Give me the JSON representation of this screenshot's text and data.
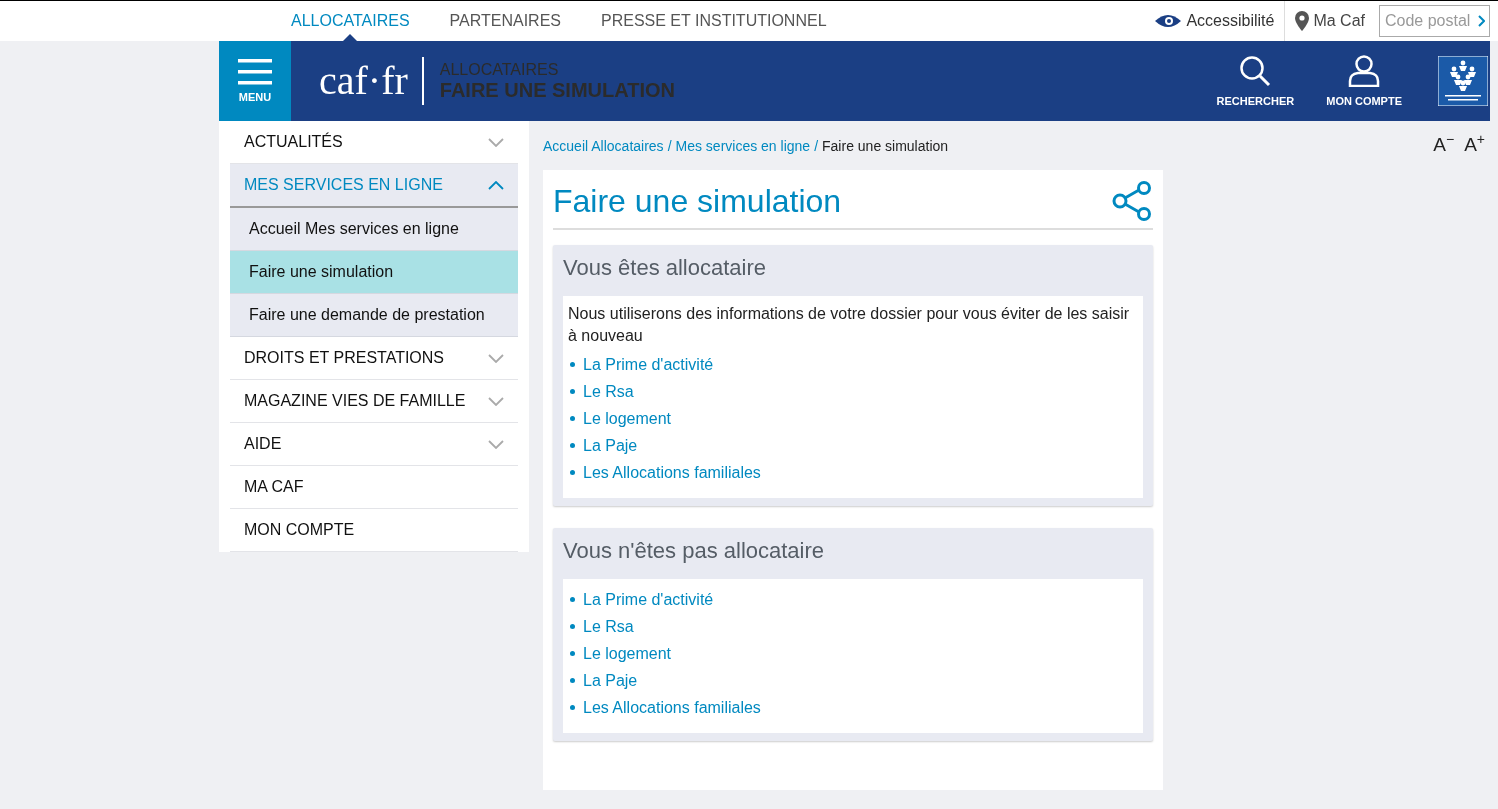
{
  "top_nav": {
    "tabs": [
      {
        "label": "ALLOCATAIRES",
        "selected": true
      },
      {
        "label": "PARTENAIRES",
        "selected": false
      },
      {
        "label": "PRESSE ET INSTITUTIONNEL",
        "selected": false
      }
    ],
    "accessibility": "Accessibilité",
    "ma_caf": "Ma Caf",
    "postal": {
      "placeholder": "Code postal"
    }
  },
  "header": {
    "menu_label": "MENU",
    "logo": "caf·fr",
    "section": "ALLOCATAIRES",
    "page": "FAIRE UNE SIMULATION",
    "actions": [
      {
        "label": "RECHERCHER",
        "kind": "search"
      },
      {
        "label": "MON COMPTE",
        "kind": "account"
      }
    ]
  },
  "sidebar": {
    "items": [
      {
        "label": "ACTUALITÉS",
        "kind": "group",
        "expanded": false
      },
      {
        "label": "MES SERVICES EN LIGNE",
        "kind": "group",
        "expanded": true,
        "children": [
          {
            "label": "Accueil Mes services en ligne",
            "selected": false
          },
          {
            "label": "Faire une simulation",
            "selected": true
          },
          {
            "label": "Faire une demande de prestation",
            "selected": false
          }
        ]
      },
      {
        "label": "DROITS ET PRESTATIONS",
        "kind": "group",
        "expanded": false
      },
      {
        "label": "MAGAZINE VIES DE FAMILLE",
        "kind": "group",
        "expanded": false
      },
      {
        "label": "AIDE",
        "kind": "group",
        "expanded": false
      },
      {
        "label": "MA CAF",
        "kind": "link"
      },
      {
        "label": "MON COMPTE",
        "kind": "link"
      }
    ]
  },
  "breadcrumb": {
    "separator": "/",
    "items": [
      {
        "label": "Accueil Allocataires",
        "kind": "link"
      },
      {
        "label": "Mes services en ligne",
        "kind": "link"
      },
      {
        "label": "Faire une simulation",
        "kind": "current"
      }
    ]
  },
  "font_size": [
    "A$^{−}$",
    "A$^{+}$"
  ],
  "title": "Faire une simulation",
  "sections": [
    {
      "title": "Vous êtes allocataire",
      "intro": "Nous utiliserons des informations de votre dossier pour vous éviter de les saisir à nouveau",
      "links": [
        "La Prime d'activité",
        "Le Rsa",
        "Le logement",
        "La Paje",
        "Les Allocations familiales"
      ]
    },
    {
      "title": "Vous n'êtes pas allocataire",
      "links": [
        "La Prime d'activité",
        "Le Rsa",
        "Le logement",
        "La Paje",
        "Les Allocations familiales"
      ]
    }
  ]
}
